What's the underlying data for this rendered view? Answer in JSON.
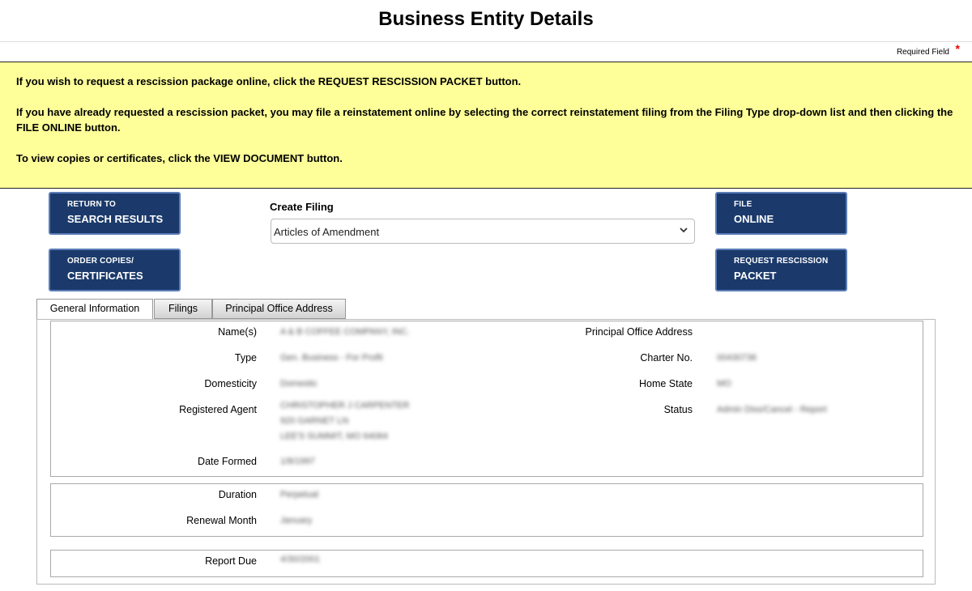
{
  "page": {
    "title": "Business Entity Details",
    "required_note": "Required Field",
    "required_star": "*"
  },
  "notice": {
    "line1": "If you wish to request a rescission package online, click the REQUEST RESCISSION PACKET button.",
    "line2": "If you have already requested a rescission packet, you may file a reinstatement online by selecting the correct reinstatement filing from the Filing Type drop-down list and then clicking the FILE ONLINE button.",
    "line3": "To view copies or certificates, click the VIEW DOCUMENT button."
  },
  "buttons": {
    "return_l1": "RETURN TO",
    "return_l2": "SEARCH RESULTS",
    "order_l1": "ORDER COPIES/",
    "order_l2": "CERTIFICATES",
    "file_l1": "FILE",
    "file_l2": "ONLINE",
    "rescind_l1": "REQUEST RESCISSION",
    "rescind_l2": "PACKET"
  },
  "filing": {
    "label": "Create Filing",
    "selected": "Articles of Amendment"
  },
  "tabs": {
    "general": "General Information",
    "filings": "Filings",
    "principal": "Principal Office Address"
  },
  "details": {
    "labels": {
      "names": "Name(s)",
      "type": "Type",
      "domesticity": "Domesticity",
      "agent": "Registered Agent",
      "date_formed": "Date Formed",
      "principal_office": "Principal Office Address",
      "charter_no": "Charter No.",
      "home_state": "Home State",
      "status": "Status",
      "duration": "Duration",
      "renewal_month": "Renewal Month",
      "report_due": "Report Due"
    },
    "values": {
      "names": "A & B COFFEE COMPANY, INC.",
      "type": "Gen. Business - For Profit",
      "domesticity": "Domestic",
      "agent_line1": "CHRISTOPHER J CARPENTER",
      "agent_line2": "920 GARNET LN",
      "agent_line3": "LEE'S SUMMIT, MO 64064",
      "date_formed": "1/8/1997",
      "charter_no": "00430736",
      "home_state": "MO",
      "status": "Admin Diss/Cancel - Report",
      "duration": "Perpetual",
      "renewal_month": "January",
      "report_due": "4/30/2001"
    }
  },
  "colors": {
    "notice_bg": "#ffff99",
    "button_bg": "#1b3a6b",
    "required_star": "#ee0000"
  }
}
